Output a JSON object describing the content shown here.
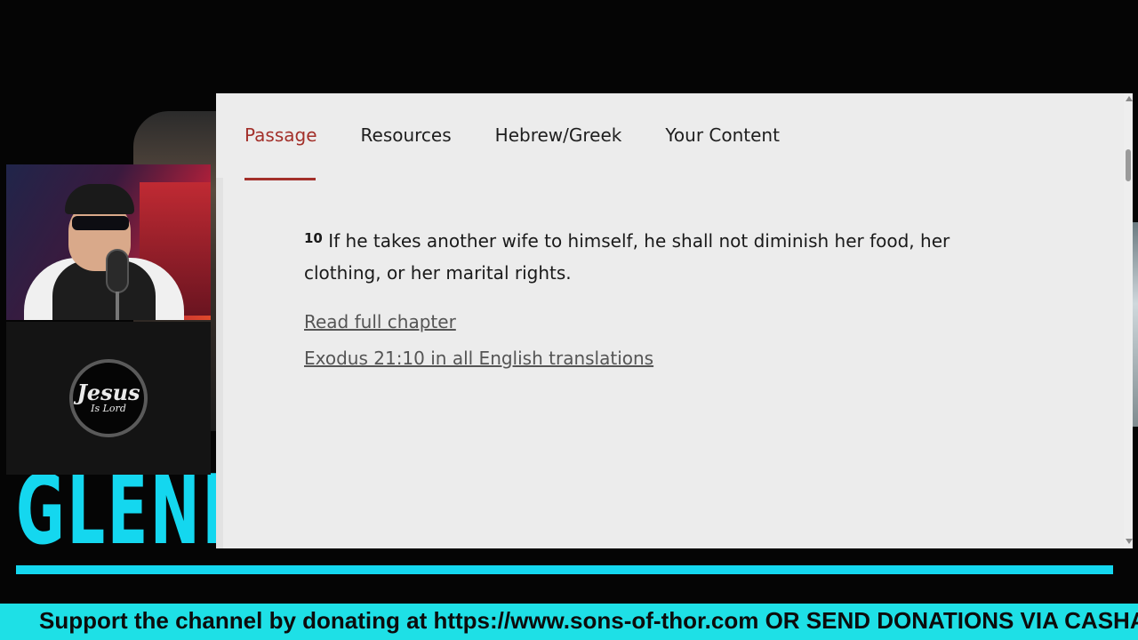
{
  "tabs": {
    "passage": "Passage",
    "resources": "Resources",
    "hebrew_greek": "Hebrew/Greek",
    "your_content": "Your Content"
  },
  "passage": {
    "verse_number": "10",
    "verse_text": "If he takes another wife to himself, he shall not diminish her food, her clothing, or her marital rights."
  },
  "links": {
    "read_full_chapter": "Read full chapter",
    "all_translations": "Exodus 21:10 in all English translations"
  },
  "overlay": {
    "logo_line1": "Jesus",
    "logo_line2": "Is Lord",
    "title_fragment": "GLENN CONTENT PRESENTS",
    "ticker": "Support the channel by donating at https://www.sons-of-thor.com OR SEND DONATIONS VIA CASHAPP"
  },
  "colors": {
    "accent": "#a3302a",
    "stream_cyan": "#14d7ef",
    "ticker_bg": "#1ee0e6"
  }
}
